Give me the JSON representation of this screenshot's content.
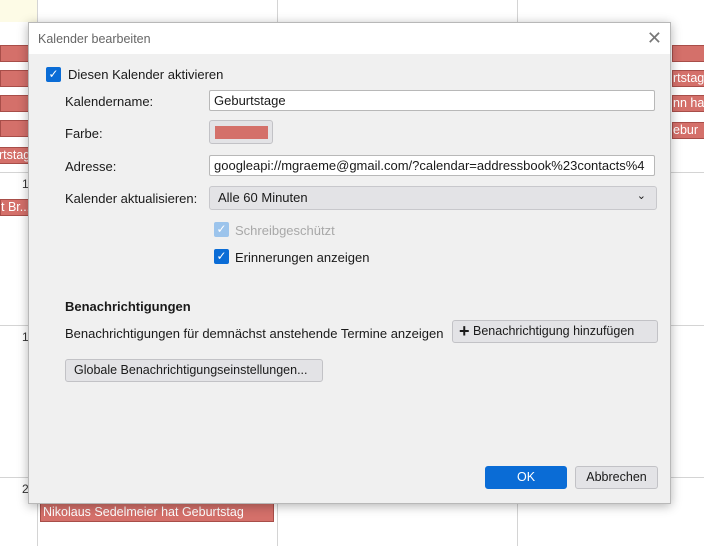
{
  "background": {
    "left_events": [
      "",
      "",
      "",
      "",
      "rtstag",
      "t Br..."
    ],
    "right_events": [
      "",
      "rtstag",
      "nn hat",
      "ebur"
    ],
    "day_numbers": [
      "1",
      "1",
      "2"
    ],
    "bottom_event": "Nikolaus Sedelmeier hat Geburtstag"
  },
  "dialog": {
    "title": "Kalender bearbeiten",
    "enable_label": "Diesen Kalender aktivieren",
    "enable_checked": true,
    "name_label": "Kalendername:",
    "name_value": "Geburtstage",
    "color_label": "Farbe:",
    "color_value": "#d4706a",
    "address_label": "Adresse:",
    "address_value": "googleapi://mgraeme@gmail.com/?calendar=addressbook%23contacts%4",
    "refresh_label": "Kalender aktualisieren:",
    "refresh_value": "Alle 60 Minuten",
    "readonly_label": "Schreibgeschützt",
    "readonly_checked": true,
    "reminders_label": "Erinnerungen anzeigen",
    "reminders_checked": true,
    "notifications_heading": "Benachrichtigungen",
    "notifications_text": "Benachrichtigungen für demnächst anstehende Termine anzeigen",
    "add_notification": "Benachrichtigung hinzufügen",
    "global_settings": "Globale Benachrichtigungseinstellungen...",
    "ok": "OK",
    "cancel": "Abbrechen"
  }
}
